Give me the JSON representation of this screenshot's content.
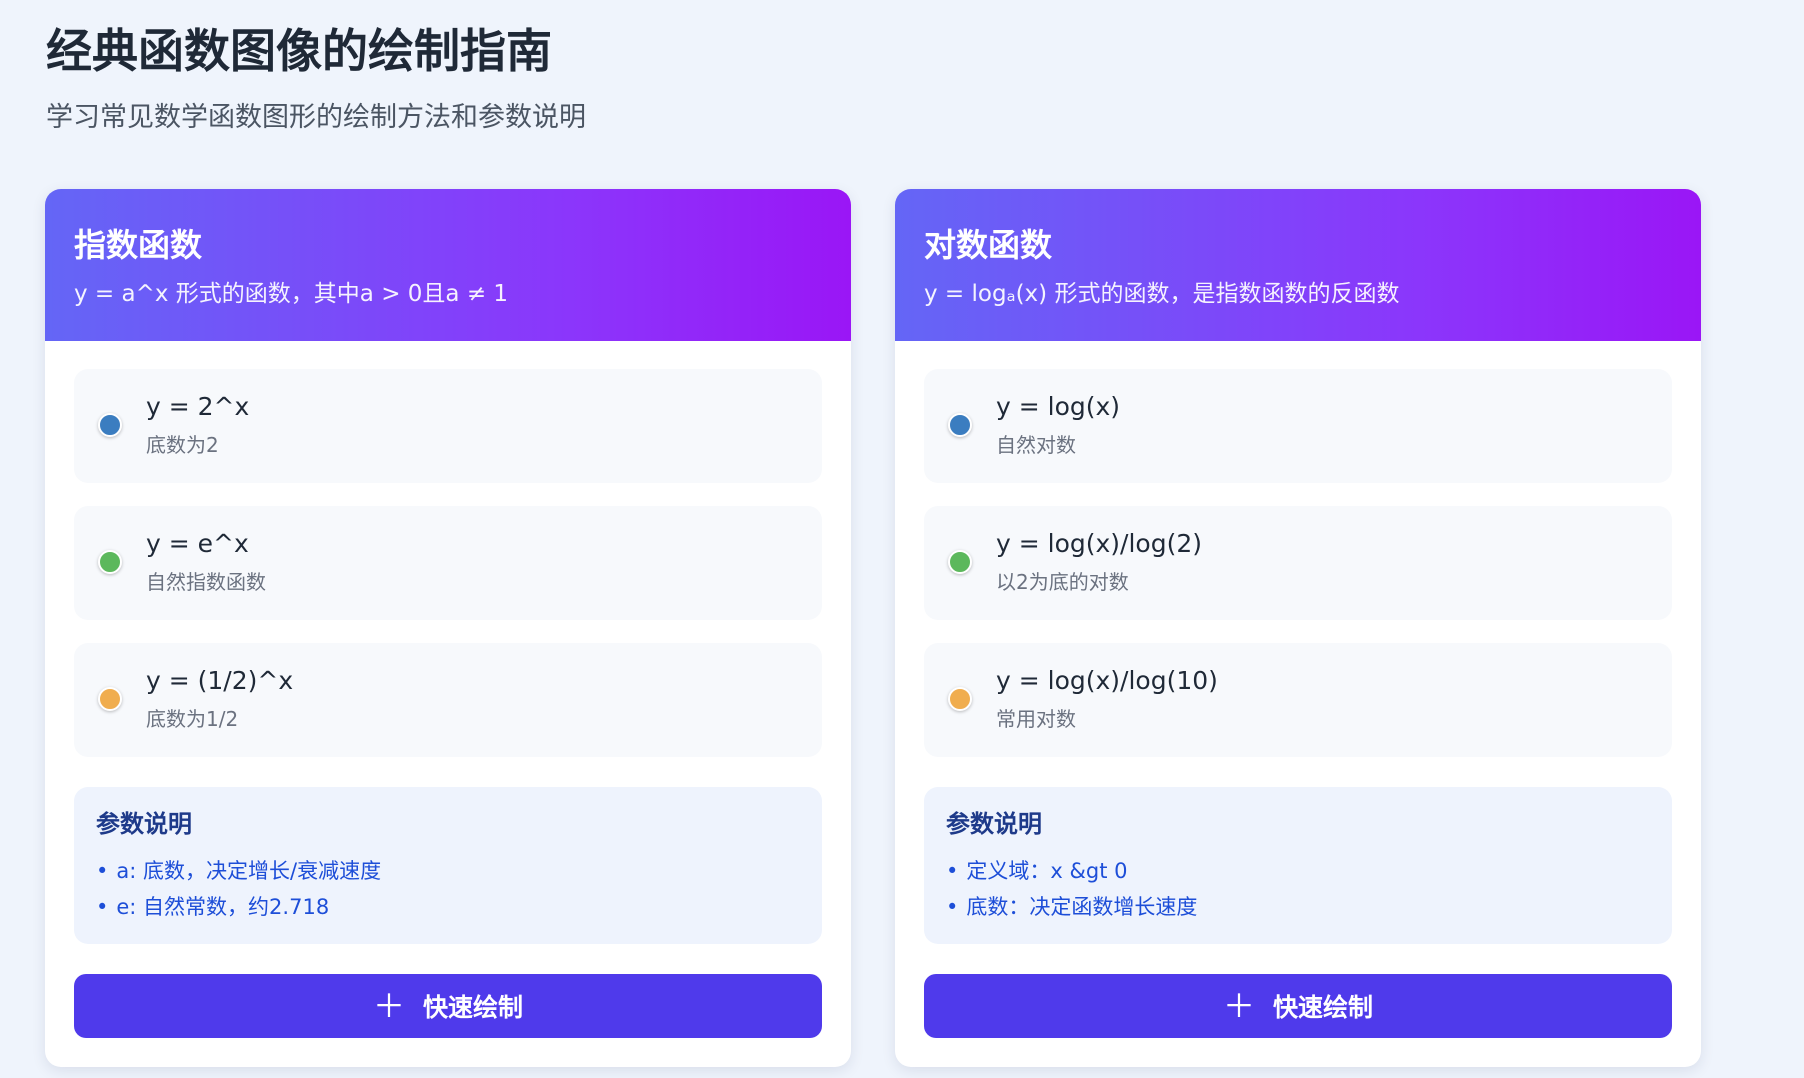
{
  "page": {
    "title": "经典函数图像的绘制指南",
    "subtitle": "学习常见数学函数图形的绘制方法和参数说明"
  },
  "colors": {
    "blue": "#3b7dc0",
    "green": "#5cb85c",
    "orange": "#f0ad4e",
    "button": "#4f3aeb"
  },
  "cards": [
    {
      "title": "指数函数",
      "description": "y = a^x 形式的函数，其中a > 0且a ≠ 1",
      "functions": [
        {
          "formula": "y = 2^x",
          "note": "底数为2",
          "color": "#3b7dc0"
        },
        {
          "formula": "y = e^x",
          "note": "自然指数函数",
          "color": "#5cb85c"
        },
        {
          "formula": "y = (1/2)^x",
          "note": "底数为1/2",
          "color": "#f0ad4e"
        }
      ],
      "params": {
        "title": "参数说明",
        "items": [
          "a: 底数，决定增长/衰减速度",
          "e: 自然常数，约2.718"
        ]
      },
      "button": {
        "icon": "plus-icon",
        "label": "快速绘制"
      }
    },
    {
      "title": "对数函数",
      "description": "y = logₐ(x) 形式的函数，是指数函数的反函数",
      "functions": [
        {
          "formula": "y = log(x)",
          "note": "自然对数",
          "color": "#3b7dc0"
        },
        {
          "formula": "y = log(x)/log(2)",
          "note": "以2为底的对数",
          "color": "#5cb85c"
        },
        {
          "formula": "y = log(x)/log(10)",
          "note": "常用对数",
          "color": "#f0ad4e"
        }
      ],
      "params": {
        "title": "参数说明",
        "items": [
          "定义域：x &gt 0",
          "底数：决定函数增长速度"
        ]
      },
      "button": {
        "icon": "plus-icon",
        "label": "快速绘制"
      }
    }
  ]
}
